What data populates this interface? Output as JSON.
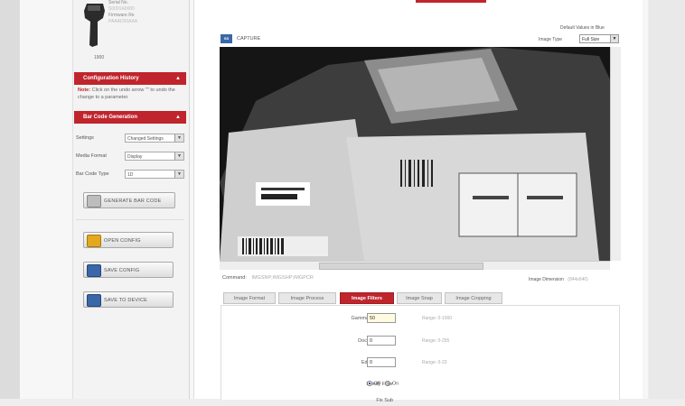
{
  "device": {
    "serial_label": "Serial No.",
    "serial_value": "S0001A0000",
    "firmware_label": "Firmware Re",
    "firmware_value": "PAAAD00AAA",
    "model": "1900"
  },
  "config_history": {
    "title": "Configuration History",
    "note_prefix": "Note:",
    "note_text": "Click on the undo arrow \"\" to undo the change to a parameter."
  },
  "barcode_gen": {
    "title": "Bar Code Generation",
    "settings_label": "Settings",
    "settings_value": "Changed Settings",
    "media_label": "Media Format",
    "media_value": "Display",
    "type_label": "Bar Code Type",
    "type_value": "1D",
    "generate_btn": "Generate Bar Code"
  },
  "actions": {
    "open_config": "Open Config",
    "save_config": "Save Config",
    "save_to_device": "Save to Device"
  },
  "header": {
    "defaults_note": "Default Values in Blue",
    "capture_icon": "SS",
    "capture_label": "CAPTURE",
    "image_type_label": "Image Type",
    "image_type_value": "Full Size"
  },
  "status": {
    "command_label": "Command",
    "command_value": "IMGSNP;IMGSHP;IMGPCR",
    "dim_label": "Image Dimension",
    "dim_value": "(844x640)"
  },
  "tabs": [
    {
      "label": "Image Format"
    },
    {
      "label": "Image Process"
    },
    {
      "label": "Image Filters"
    },
    {
      "label": "Image Snap"
    },
    {
      "label": "Image Cropping"
    }
  ],
  "filters": {
    "gamma_label": "Gamma Correction",
    "gamma_value": "50",
    "gamma_range": "Range: 0-1000",
    "document_label": "Document Filter",
    "document_value": "0",
    "document_range": "Range: 0-255",
    "edge_label": "Edge Sharpen",
    "edge_value": "0",
    "edge_range": "Range: 0-23",
    "infinity_label": "Infinity Filter",
    "infinity_off": "Off",
    "infinity_on": "On",
    "next_label": "Fix Sub"
  },
  "colors": {
    "accent": "#c0252d",
    "capture_blue": "#3a67a8"
  }
}
